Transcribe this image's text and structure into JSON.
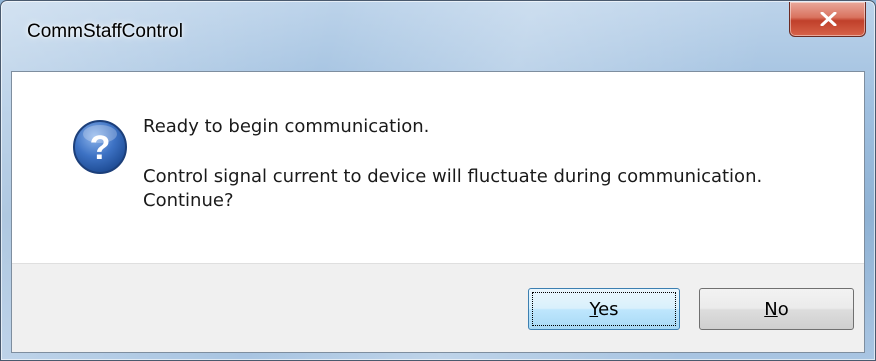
{
  "window": {
    "title": "CommStaffControl"
  },
  "message": {
    "line1": "Ready to begin communication.",
    "line2": "Control signal current to device will fluctuate during communication.",
    "line3": "Continue?"
  },
  "buttons": {
    "yes": {
      "accel": "Y",
      "rest": "es"
    },
    "no": {
      "accel": "N",
      "rest": "o"
    }
  },
  "icons": {
    "question": "question-icon",
    "close": "close-icon"
  },
  "colors": {
    "icon_blue": "#2e5fa8",
    "close_red": "#c0402a",
    "default_button_border": "#3c7fb1"
  }
}
